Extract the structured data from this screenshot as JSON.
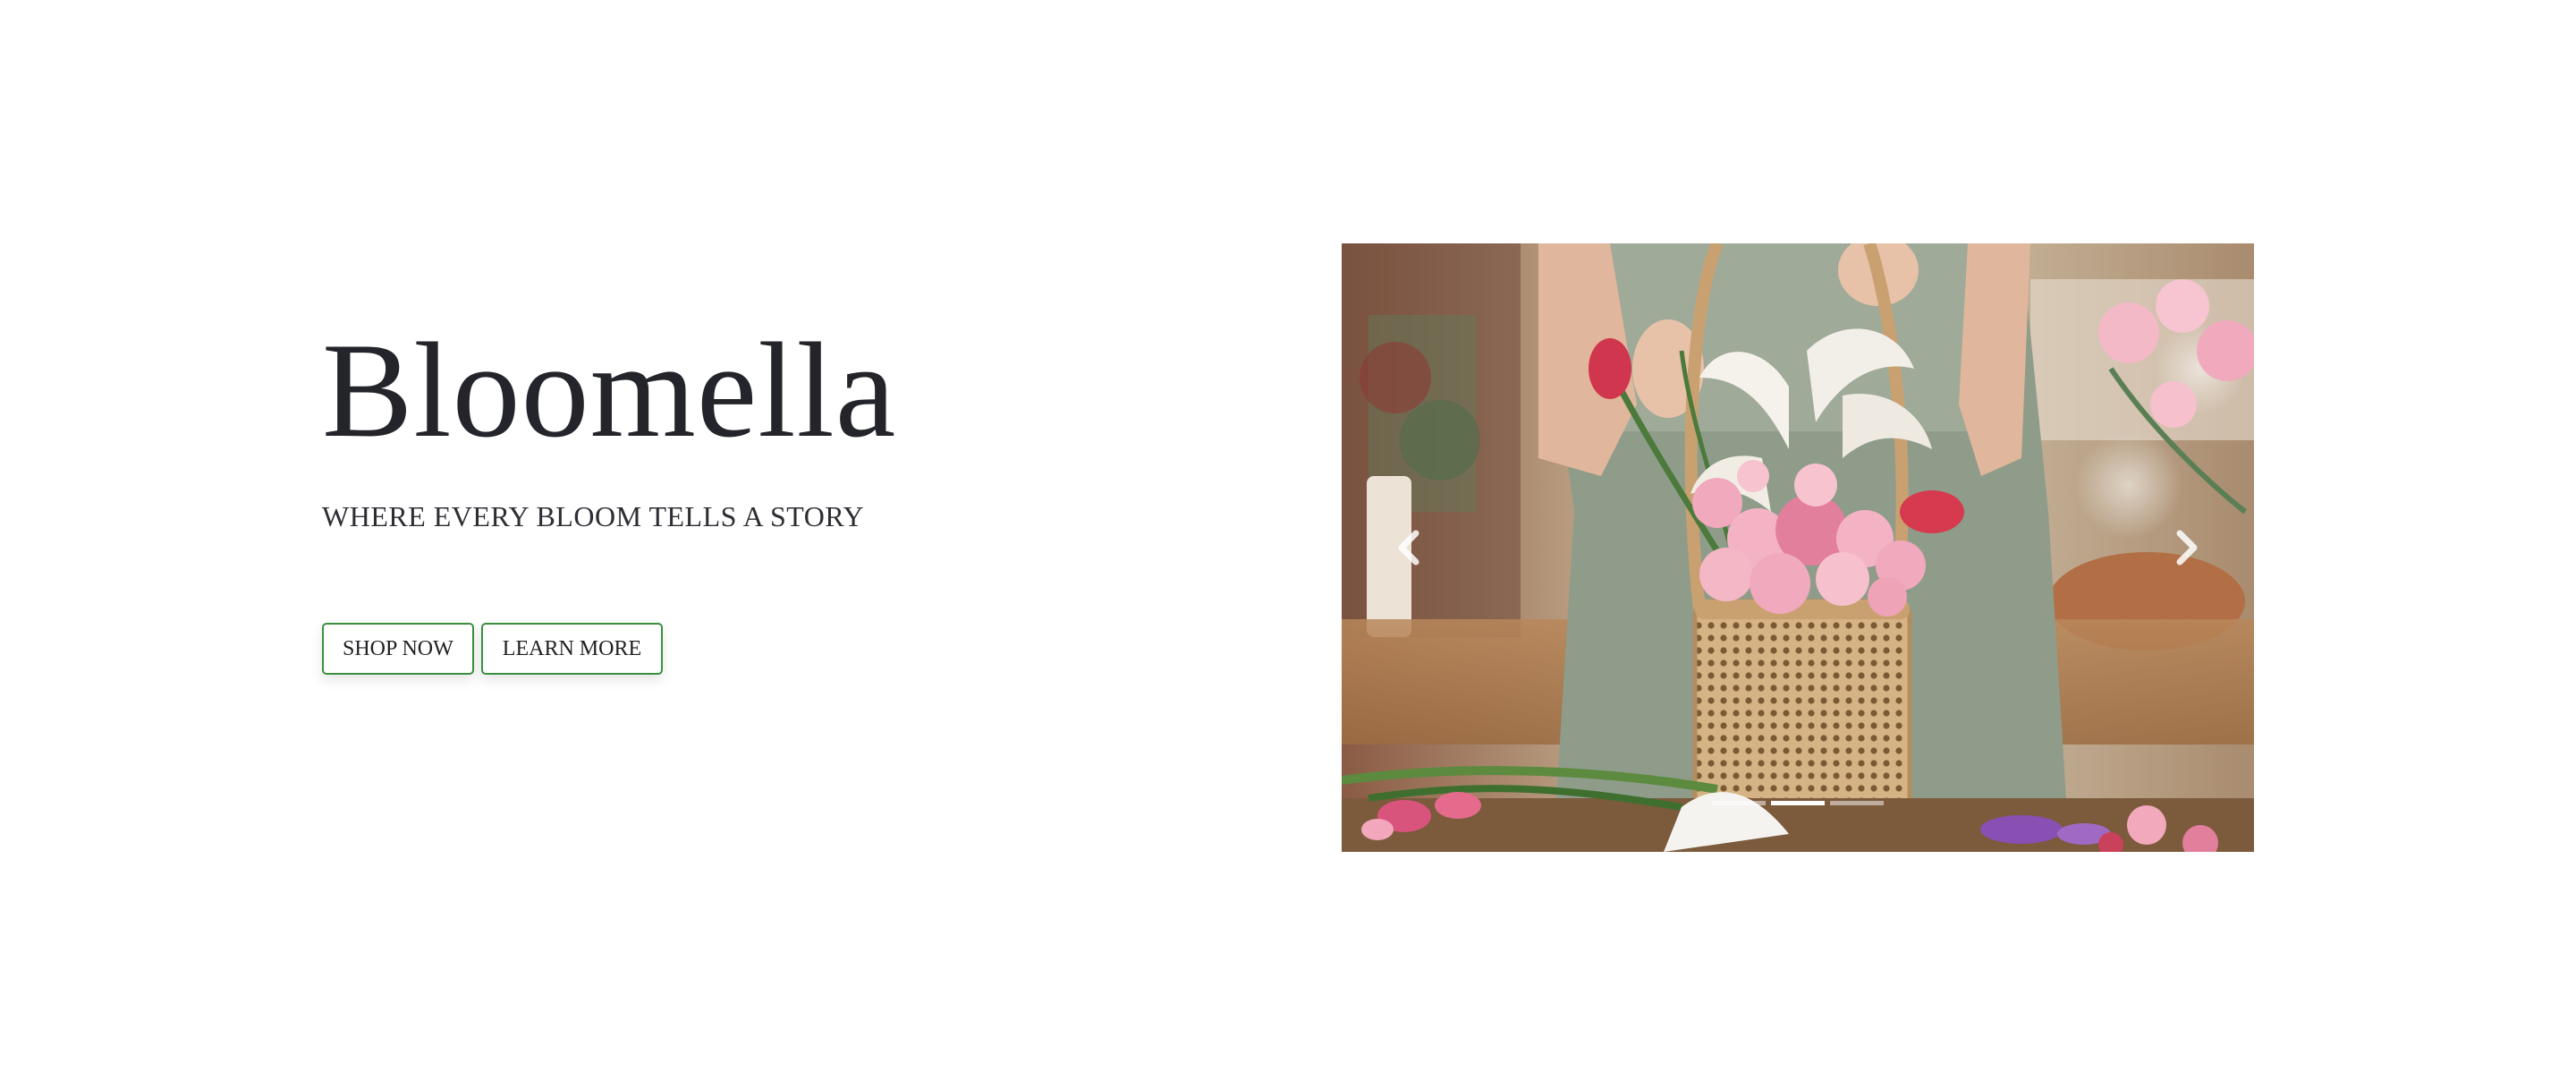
{
  "hero": {
    "brand": "Bloomella",
    "tagline": "WHERE EVERY BLOOM TELLS A STORY",
    "shop_button": "SHOP NOW",
    "learn_button": "LEARN MORE"
  },
  "carousel": {
    "slide_count": 3,
    "active_slide": 1,
    "prev_icon": "chevron-left-icon",
    "next_icon": "chevron-right-icon"
  },
  "colors": {
    "button_border": "#3a8f3f",
    "title": "#24252b",
    "background": "#ffffff"
  }
}
